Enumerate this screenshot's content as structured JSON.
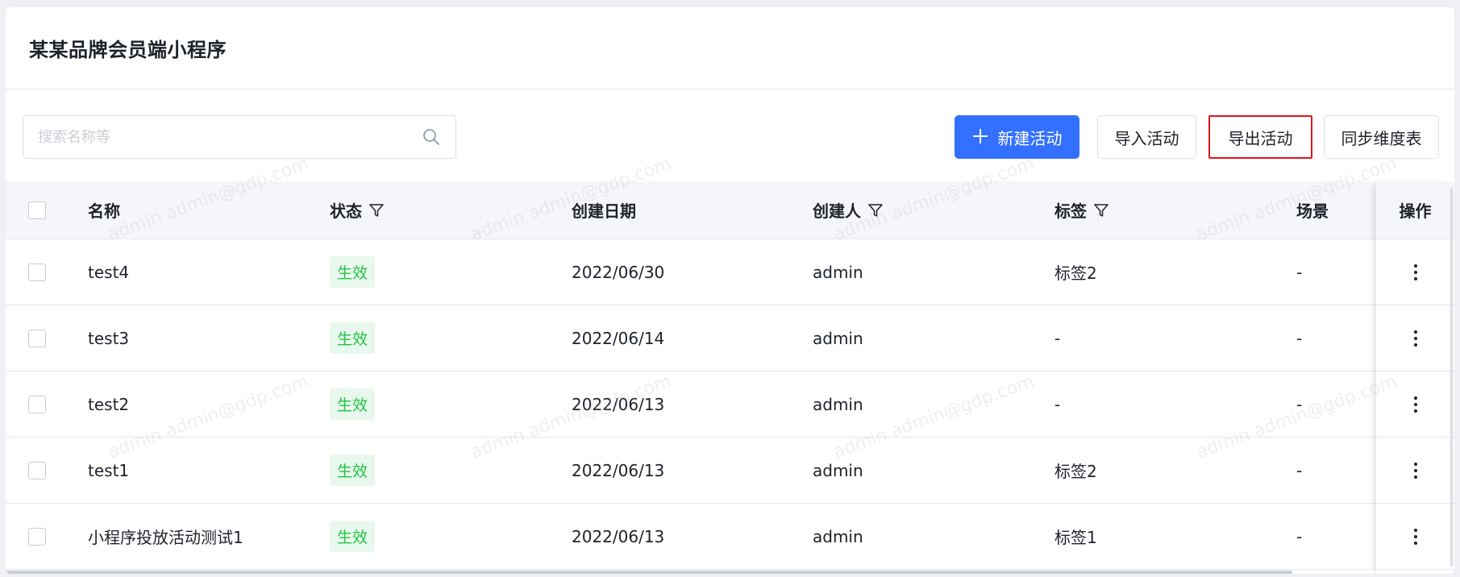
{
  "page": {
    "title": "某某品牌会员端小程序"
  },
  "search": {
    "placeholder": "搜索名称等"
  },
  "toolbar": {
    "new_label": "新建活动",
    "import_label": "导入活动",
    "export_label": "导出活动",
    "sync_label": "同步维度表"
  },
  "table": {
    "headers": {
      "name": "名称",
      "status": "状态",
      "date": "创建日期",
      "creator": "创建人",
      "tags": "标签",
      "scene": "场景",
      "actions": "操作"
    },
    "rows": [
      {
        "name": "test4",
        "status": "生效",
        "date": "2022/06/30",
        "creator": "admin",
        "tags": "标签2",
        "scene": "-"
      },
      {
        "name": "test3",
        "status": "生效",
        "date": "2022/06/14",
        "creator": "admin",
        "tags": "-",
        "scene": "-"
      },
      {
        "name": "test2",
        "status": "生效",
        "date": "2022/06/13",
        "creator": "admin",
        "tags": "-",
        "scene": "-"
      },
      {
        "name": "test1",
        "status": "生效",
        "date": "2022/06/13",
        "creator": "admin",
        "tags": "标签2",
        "scene": "-"
      },
      {
        "name": "小程序投放活动测试1",
        "status": "生效",
        "date": "2022/06/13",
        "creator": "admin",
        "tags": "标签1",
        "scene": "-"
      }
    ]
  },
  "watermark": {
    "text": "admin admin@gdp.com"
  },
  "colors": {
    "primary": "#3370ff",
    "status_active": "#23c343",
    "highlight_border": "#e0151e"
  },
  "icons": {
    "search": "search-icon",
    "filter": "filter-icon",
    "more": "more-vertical-icon",
    "plus": "plus-icon"
  }
}
